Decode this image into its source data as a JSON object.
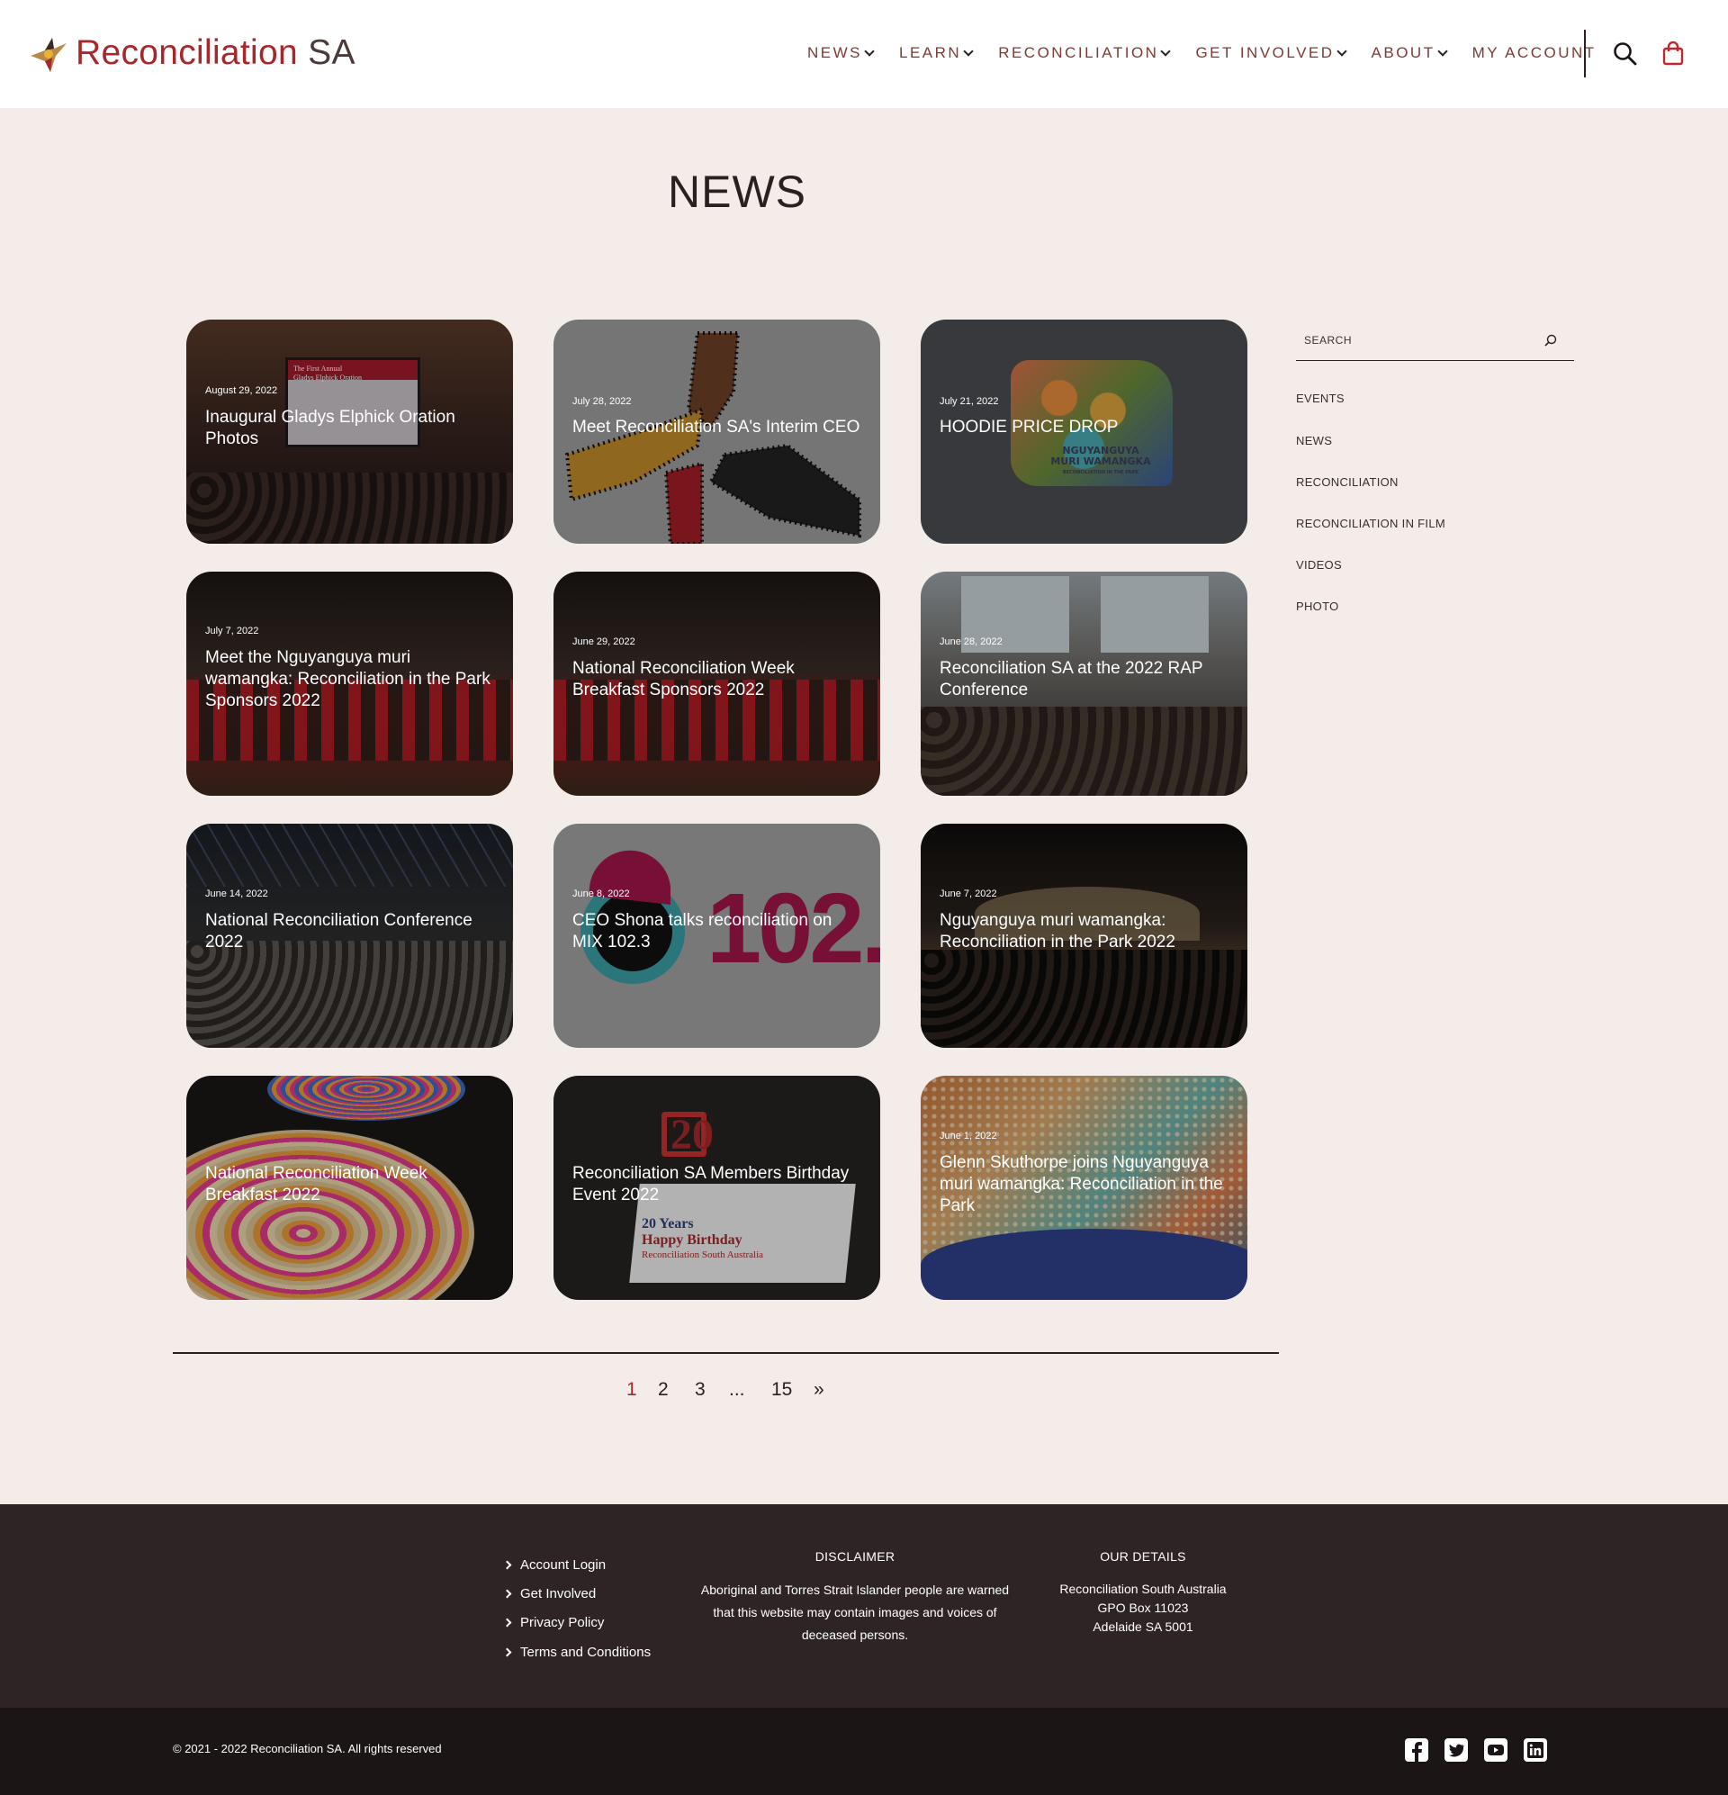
{
  "brand": {
    "name_red": "Reconciliation",
    "name_dark": "SA"
  },
  "nav": {
    "items": [
      {
        "label": "NEWS",
        "dropdown": true
      },
      {
        "label": "LEARN",
        "dropdown": true
      },
      {
        "label": "RECONCILIATION",
        "dropdown": true
      },
      {
        "label": "GET INVOLVED",
        "dropdown": true
      },
      {
        "label": "ABOUT",
        "dropdown": true
      },
      {
        "label": "MY ACCOUNT",
        "dropdown": false
      }
    ],
    "icons": [
      "search-icon",
      "shopping-bag-icon"
    ]
  },
  "page": {
    "title": "NEWS"
  },
  "posts": [
    {
      "date": "August 29, 2022",
      "title": "Inaugural Gladys Elphick Oration Photos"
    },
    {
      "date": "July 28, 2022",
      "title": "Meet Reconciliation SA's Interim CEO"
    },
    {
      "date": "July 21, 2022",
      "title": "HOODIE PRICE DROP"
    },
    {
      "date": "July 7, 2022",
      "title": "Meet the Nguyanguya muri wamangka: Reconciliation in the Park Sponsors 2022"
    },
    {
      "date": "June 29, 2022",
      "title": "National Reconciliation Week Breakfast Sponsors 2022"
    },
    {
      "date": "June 28, 2022",
      "title": "Reconciliation SA at the 2022 RAP Conference"
    },
    {
      "date": "June 14, 2022",
      "title": "National Reconciliation Conference 2022"
    },
    {
      "date": "June 8, 2022",
      "title": "CEO Shona talks reconciliation on MIX 102.3"
    },
    {
      "date": "June 7, 2022",
      "title": "Nguyanguya muri wamangka: Reconciliation in the Park 2022"
    },
    {
      "date": "",
      "title": "National Reconciliation Week Breakfast 2022"
    },
    {
      "date": "",
      "title": "Reconciliation SA Members Birthday Event 2022"
    },
    {
      "date": "June 1, 2022",
      "title": "Glenn Skuthorpe joins Nguyanguya muri wamangka: Reconciliation in the Park"
    }
  ],
  "image_text": {
    "oration_screen": [
      "The First Annual",
      "Gladys Elphick Oration"
    ],
    "hoodie": [
      "NGUYANGUYA",
      "MURI WAMANGKA",
      "RECONCILIATION IN THE PARK"
    ],
    "mix_logo": "102.",
    "cake": [
      "20",
      "20 Years",
      "Happy Birthday",
      "Reconciliation South Australia"
    ]
  },
  "sidebar": {
    "search_placeholder": "SEARCH",
    "categories": [
      "EVENTS",
      "NEWS",
      "RECONCILIATION",
      "RECONCILIATION IN FILM",
      "VIDEOS",
      "PHOTO"
    ]
  },
  "pagination": {
    "pages": [
      "1",
      "2",
      "3",
      "...",
      "15",
      "»"
    ],
    "current": "1"
  },
  "footer": {
    "links": [
      "Account Login",
      "Get Involved",
      "Privacy Policy",
      "Terms and Conditions"
    ],
    "disclaimer_heading": "DISCLAIMER",
    "disclaimer_lines": [
      "Aboriginal and Torres Strait Islander people are warned",
      "that this website may contain images and voices of",
      "deceased persons."
    ],
    "details_heading": "OUR DETAILS",
    "details_lines": [
      "Reconciliation South Australia",
      "GPO Box 11023",
      "Adelaide SA 5001"
    ],
    "copyright": "© 2021 - 2022 Reconciliation SA. All rights reserved",
    "social_icons": [
      "facebook-icon",
      "twitter-icon",
      "youtube-icon",
      "linkedin-icon"
    ]
  },
  "colors": {
    "brand_red": "#a6282b",
    "page_bg": "#f3ece8",
    "footer_bg": "#2f2425",
    "subfooter_bg": "#1c1516"
  }
}
